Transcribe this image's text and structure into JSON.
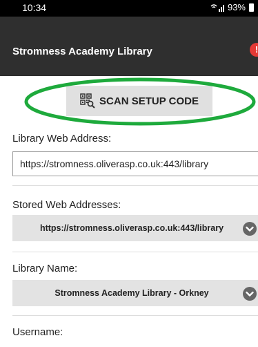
{
  "status_bar": {
    "time": "10:34",
    "battery": "93%"
  },
  "header": {
    "title": "Stromness Academy Library",
    "help_icon": "!"
  },
  "scan": {
    "label": "SCAN SETUP CODE",
    "icon": "qr-code-icon",
    "highlight_color": "#1eaa3c"
  },
  "form": {
    "web_address_label": "Library Web Address:",
    "web_address_value": "https://stromness.oliverasp.co.uk:443/library",
    "stored_label": "Stored Web Addresses:",
    "stored_value": "https://stromness.oliverasp.co.uk:443/library",
    "library_name_label": "Library Name:",
    "library_name_value": "Stromness Academy Library - Orkney",
    "username_label": "Username:"
  }
}
